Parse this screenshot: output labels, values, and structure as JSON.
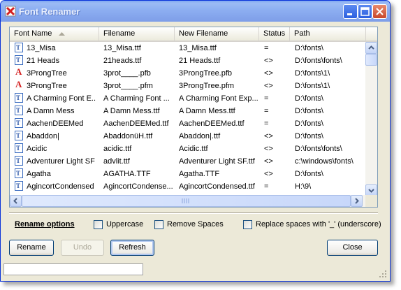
{
  "window": {
    "title": "Font Renamer"
  },
  "columns": [
    {
      "label": "Font Name",
      "sorted": "ascending"
    },
    {
      "label": "Filename"
    },
    {
      "label": "New Filename"
    },
    {
      "label": "Status"
    },
    {
      "label": "Path"
    }
  ],
  "rows": [
    {
      "type": "truetype",
      "font_name": "13_Misa",
      "filename": "13_Misa.ttf",
      "new_filename": "13_Misa.ttf",
      "status": "=",
      "path": "D:\\fonts\\"
    },
    {
      "type": "truetype",
      "font_name": "21 Heads",
      "filename": "21heads.ttf",
      "new_filename": "21 Heads.ttf",
      "status": "<>",
      "path": "D:\\fonts\\fonts\\"
    },
    {
      "type": "type1",
      "font_name": "3ProngTree",
      "filename": "3prot____.pfb",
      "new_filename": "3ProngTree.pfb",
      "status": "<>",
      "path": "D:\\fonts\\1\\"
    },
    {
      "type": "type1",
      "font_name": "3ProngTree",
      "filename": "3prot____.pfm",
      "new_filename": "3ProngTree.pfm",
      "status": "<>",
      "path": "D:\\fonts\\1\\"
    },
    {
      "type": "truetype",
      "font_name": "A Charming Font E...",
      "filename": "A Charming Font ...",
      "new_filename": "A Charming Font Exp...",
      "status": "=",
      "path": "D:\\fonts\\"
    },
    {
      "type": "truetype",
      "font_name": "A Damn Mess",
      "filename": "A Damn Mess.ttf",
      "new_filename": "A Damn Mess.ttf",
      "status": "=",
      "path": "D:\\fonts\\"
    },
    {
      "type": "truetype",
      "font_name": "AachenDEEMed",
      "filename": "AachenDEEMed.ttf",
      "new_filename": "AachenDEEMed.ttf",
      "status": "=",
      "path": "D:\\fonts\\"
    },
    {
      "type": "truetype",
      "font_name": "Abaddon|",
      "filename": "AbaddonüH.ttf",
      "new_filename": "Abaddon|.ttf",
      "status": "<>",
      "path": "D:\\fonts\\"
    },
    {
      "type": "truetype",
      "font_name": "Acidic",
      "filename": "acidic.ttf",
      "new_filename": "Acidic.ttf",
      "status": "<>",
      "path": "D:\\fonts\\fonts\\"
    },
    {
      "type": "truetype",
      "font_name": "Adventurer Light SF",
      "filename": "advlit.ttf",
      "new_filename": "Adventurer Light SF.ttf",
      "status": "<>",
      "path": "c:\\windows\\fonts\\"
    },
    {
      "type": "truetype",
      "font_name": "Agatha",
      "filename": "AGATHA.TTF",
      "new_filename": "Agatha.TTF",
      "status": "<>",
      "path": "D:\\fonts\\"
    },
    {
      "type": "truetype",
      "font_name": "AgincortCondensed",
      "filename": "AgincortCondense...",
      "new_filename": "AgincortCondensed.ttf",
      "status": "=",
      "path": "H:\\9\\"
    }
  ],
  "rename_options": {
    "title": "Rename options",
    "uppercase": {
      "label": "Uppercase",
      "checked": false
    },
    "remove_spaces": {
      "label": "Remove Spaces",
      "checked": false
    },
    "replace_spaces": {
      "label": "Replace spaces with '_' (underscore)",
      "checked": false
    }
  },
  "buttons": {
    "rename": "Rename",
    "undo": "Undo",
    "refresh": "Refresh",
    "close": "Close"
  },
  "status_bar": {
    "text": ""
  },
  "icons": {
    "app": "font-renamer-app-icon",
    "truetype": "truetype-font-icon",
    "type1": "type1-font-icon"
  },
  "colors": {
    "titlebar": "#8eb0f2",
    "close_button": "#c9472a",
    "list_border": "#7f9db9"
  }
}
